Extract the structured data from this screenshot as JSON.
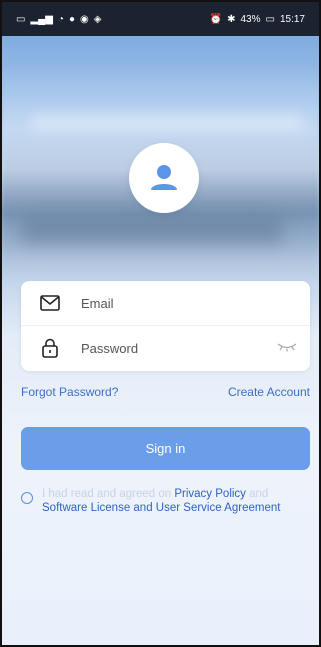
{
  "status_bar": {
    "left_icons": [
      "sim-icon",
      "signal-icon",
      "wifi-icon",
      "messaging-icon",
      "app-icon",
      "app-icon-2"
    ],
    "battery": "43%",
    "time": "15:17"
  },
  "form": {
    "email_placeholder": "Email",
    "password_placeholder": "Password"
  },
  "links": {
    "forgot_password": "Forgot Password?",
    "create_account": "Create Account"
  },
  "buttons": {
    "sign_in": "Sign in"
  },
  "agreement": {
    "prefix": "I had read and agreed on ",
    "privacy_policy": "Privacy Policy",
    "and": " and ",
    "software_license": "Software License and User Service Agreement"
  },
  "colors": {
    "accent": "#6a9ee9",
    "link": "#3b6fc6"
  }
}
